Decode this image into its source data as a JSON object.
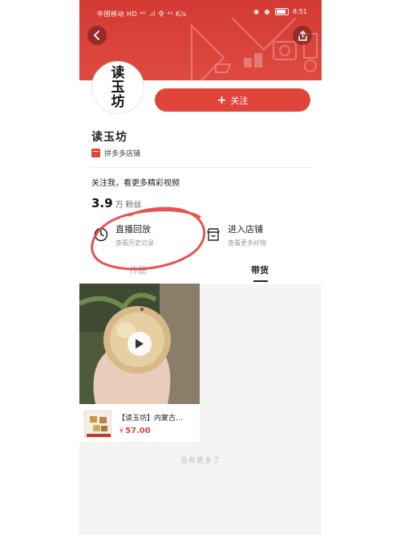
{
  "status_bar": {
    "carrier": "中国移动 HD ⁴ᴳ .ıl 令 ⁴² K/s",
    "time": "8:51"
  },
  "colors": {
    "header_red": "#d23a33",
    "accent_red": "#e0443a"
  },
  "header": {
    "back_icon": "chevron-left-icon",
    "share_icon": "share-icon"
  },
  "profile": {
    "avatar_text": "读玉坊",
    "follow_label": "关注",
    "shop_name": "读玉坊",
    "tag_label": "拼多多店铺",
    "description": "关注我，看更多精彩视频",
    "fans_value": "3.9",
    "fans_unit": "万",
    "fans_label": "粉丝"
  },
  "entries": {
    "live": {
      "title": "直播回放",
      "subtitle": "查看历史记录",
      "icon": "clock-icon"
    },
    "shop": {
      "title": "进入店铺",
      "subtitle": "查看更多好物",
      "icon": "store-icon"
    }
  },
  "tabs": {
    "works": "作品",
    "goods": "带货",
    "active": "goods"
  },
  "product": {
    "title": "【读玉坊】内蒙古…",
    "currency": "¥",
    "price": "57.00"
  },
  "footer": {
    "no_more": "没有更多了"
  }
}
